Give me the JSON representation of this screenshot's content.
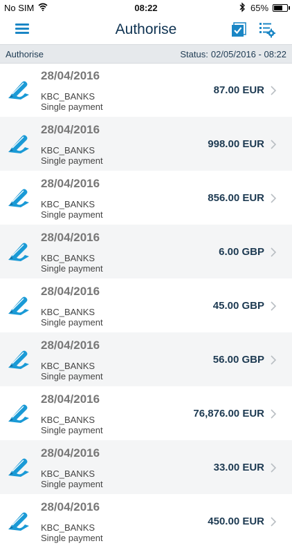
{
  "status_bar": {
    "carrier": "No SIM",
    "time": "08:22",
    "battery": "65%",
    "battery_level": 0.65
  },
  "nav": {
    "title": "Authorise",
    "menu_icon": "hamburger-menu-icon",
    "select_icon": "checkbox-select-icon",
    "settings_icon": "list-settings-icon"
  },
  "subheader": {
    "title": "Authorise",
    "status_label": "Status:",
    "status_value": "02/05/2016 - 08:22"
  },
  "colors": {
    "accent": "#1a86c5",
    "title": "#0f3352",
    "amount": "#1d3a52",
    "subheader_bg": "#e6e9ec",
    "alt_row": "#f4f5f6"
  },
  "payments": [
    {
      "date": "28/04/2016",
      "bank": "KBC_BANKS",
      "type": "Single payment",
      "amount": "87.00 EUR"
    },
    {
      "date": "28/04/2016",
      "bank": "KBC_BANKS",
      "type": "Single payment",
      "amount": "998.00 EUR"
    },
    {
      "date": "28/04/2016",
      "bank": "KBC_BANKS",
      "type": "Single payment",
      "amount": "856.00 EUR"
    },
    {
      "date": "28/04/2016",
      "bank": "KBC_BANKS",
      "type": "Single payment",
      "amount": "6.00 GBP"
    },
    {
      "date": "28/04/2016",
      "bank": "KBC_BANKS",
      "type": "Single payment",
      "amount": "45.00 GBP"
    },
    {
      "date": "28/04/2016",
      "bank": "KBC_BANKS",
      "type": "Single payment",
      "amount": "56.00 GBP"
    },
    {
      "date": "28/04/2016",
      "bank": "KBC_BANKS",
      "type": "Single payment",
      "amount": "76,876.00 EUR"
    },
    {
      "date": "28/04/2016",
      "bank": "KBC_BANKS",
      "type": "Single payment",
      "amount": "33.00 EUR"
    },
    {
      "date": "28/04/2016",
      "bank": "KBC_BANKS",
      "type": "Single payment",
      "amount": "450.00 EUR"
    }
  ]
}
